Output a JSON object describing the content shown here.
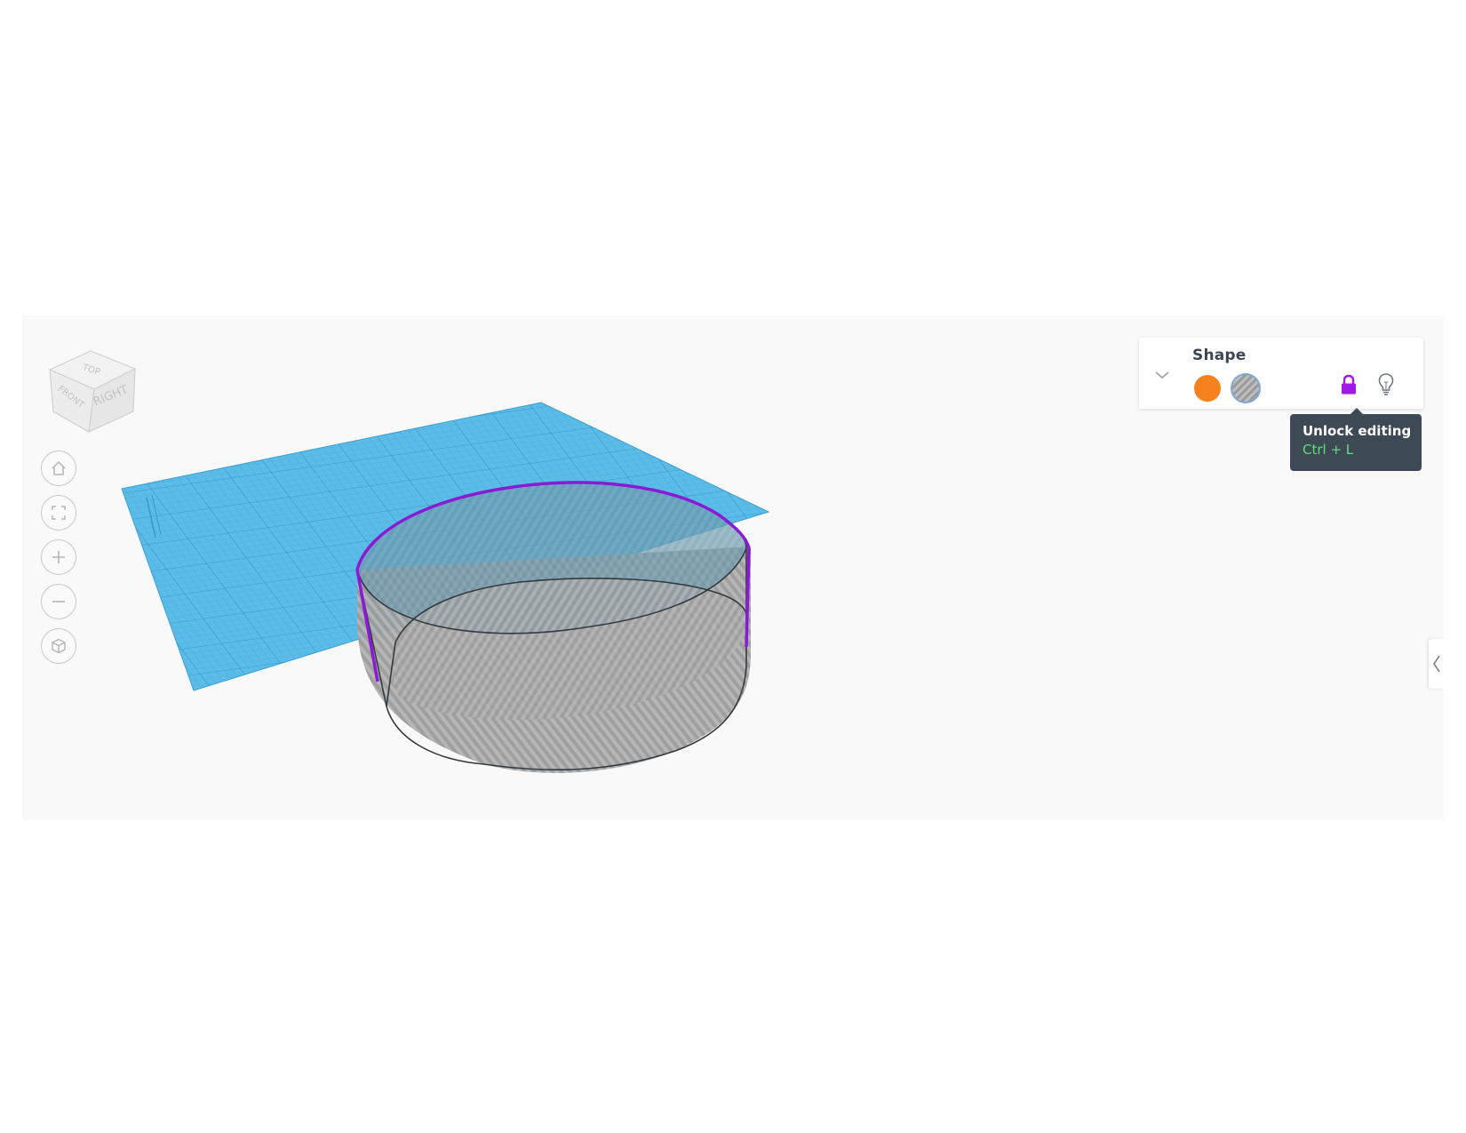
{
  "shape_panel": {
    "title": "Shape",
    "collapse_icon": "chevron-down-icon",
    "solid_swatch": {
      "label": "Solid",
      "color": "#f5821f"
    },
    "hole_swatch": {
      "label": "Hole",
      "selected": true,
      "color": "#a6a6a6"
    },
    "lock_icon": "lock-icon",
    "lock_color": "#9f1ae2",
    "light_icon": "lightbulb-icon"
  },
  "tooltip": {
    "title": "Unlock editing",
    "shortcut": "Ctrl + L"
  },
  "viewcube": {
    "top_label": "TOP",
    "front_label": "FRONT",
    "right_label": "RIGHT"
  },
  "nav_controls": [
    {
      "name": "home-view-button",
      "icon": "home-icon"
    },
    {
      "name": "fit-view-button",
      "icon": "fit-frame-icon"
    },
    {
      "name": "zoom-in-button",
      "icon": "plus-icon"
    },
    {
      "name": "zoom-out-button",
      "icon": "minus-icon"
    },
    {
      "name": "projection-toggle-button",
      "icon": "cube-icon"
    }
  ],
  "colors": {
    "workplane": "#4fb3e3",
    "selection_outline": "#8b1ad4",
    "accent_lock": "#9f1ae2",
    "tooltip_bg": "#3d4955",
    "shortcut_text": "#5fe07e"
  },
  "side_panel_toggle": {
    "icon": "chevron-left-icon"
  }
}
